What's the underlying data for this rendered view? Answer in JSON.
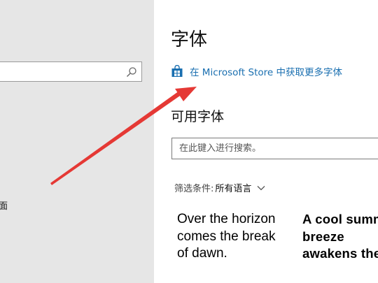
{
  "sidebar": {
    "search": {
      "placeholder": "",
      "icon": "search-icon"
    },
    "items": [
      {
        "label": "面"
      }
    ]
  },
  "main": {
    "title": "字体",
    "store_link": {
      "label": "在 Microsoft Store 中获取更多字体",
      "icon": "store-bag-icon"
    },
    "available_fonts_title": "可用字体",
    "search": {
      "placeholder": "在此键入进行搜索。"
    },
    "filter": {
      "label": "筛选条件:",
      "value": "所有语言",
      "icon": "chevron-down-icon"
    },
    "previews": [
      {
        "text": "Over the horizon comes the break of dawn."
      },
      {
        "line1": "A cool summ",
        "line2": "breeze",
        "line3": "awakens the"
      }
    ]
  },
  "colors": {
    "accent": "#1a6fb0",
    "sidebar_bg": "#e6e6e6",
    "arrow": "#e53935"
  }
}
